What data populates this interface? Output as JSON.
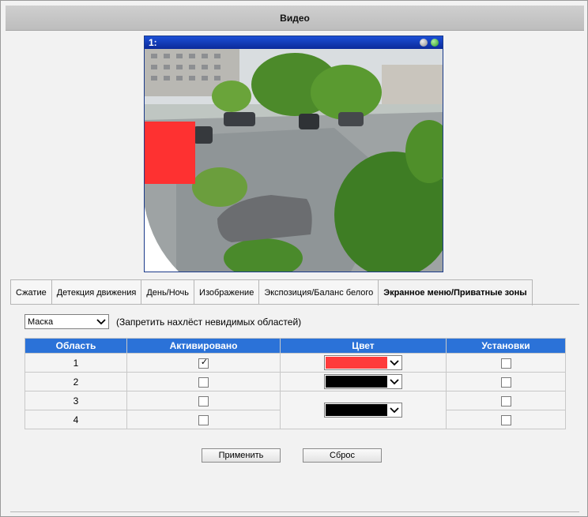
{
  "window": {
    "title": "Видео"
  },
  "video": {
    "channel_label": "1:"
  },
  "tabs": [
    {
      "label": "Сжатие",
      "active": false
    },
    {
      "label": "Детекция движения",
      "active": false
    },
    {
      "label": "День/Ночь",
      "active": false
    },
    {
      "label": "Изображение",
      "active": false
    },
    {
      "label": "Экспозиция/Баланс белого",
      "active": false
    },
    {
      "label": "Экранное меню/Приватные зоны",
      "active": true
    }
  ],
  "mode": {
    "value": "Маска",
    "hint": "(Запретить нахлёст невидимых областей)"
  },
  "table": {
    "headers": [
      "Область",
      "Активировано",
      "Цвет",
      "Установки"
    ],
    "rows": [
      {
        "area": "1",
        "active": true,
        "color": "#ff3b3b",
        "settings": false
      },
      {
        "area": "2",
        "active": false,
        "color": "#000000",
        "settings": false
      },
      {
        "area": "3",
        "active": false,
        "color": "#000000",
        "settings": false
      },
      {
        "area": "4",
        "active": false,
        "settings": false
      }
    ]
  },
  "checkmark": "✓",
  "buttons": {
    "apply": "Применить",
    "reset": "Сброс"
  },
  "colors": {
    "header_bg": "#2b72d8",
    "mask": "#fe3131",
    "title_bar": "#c6c6c6"
  }
}
